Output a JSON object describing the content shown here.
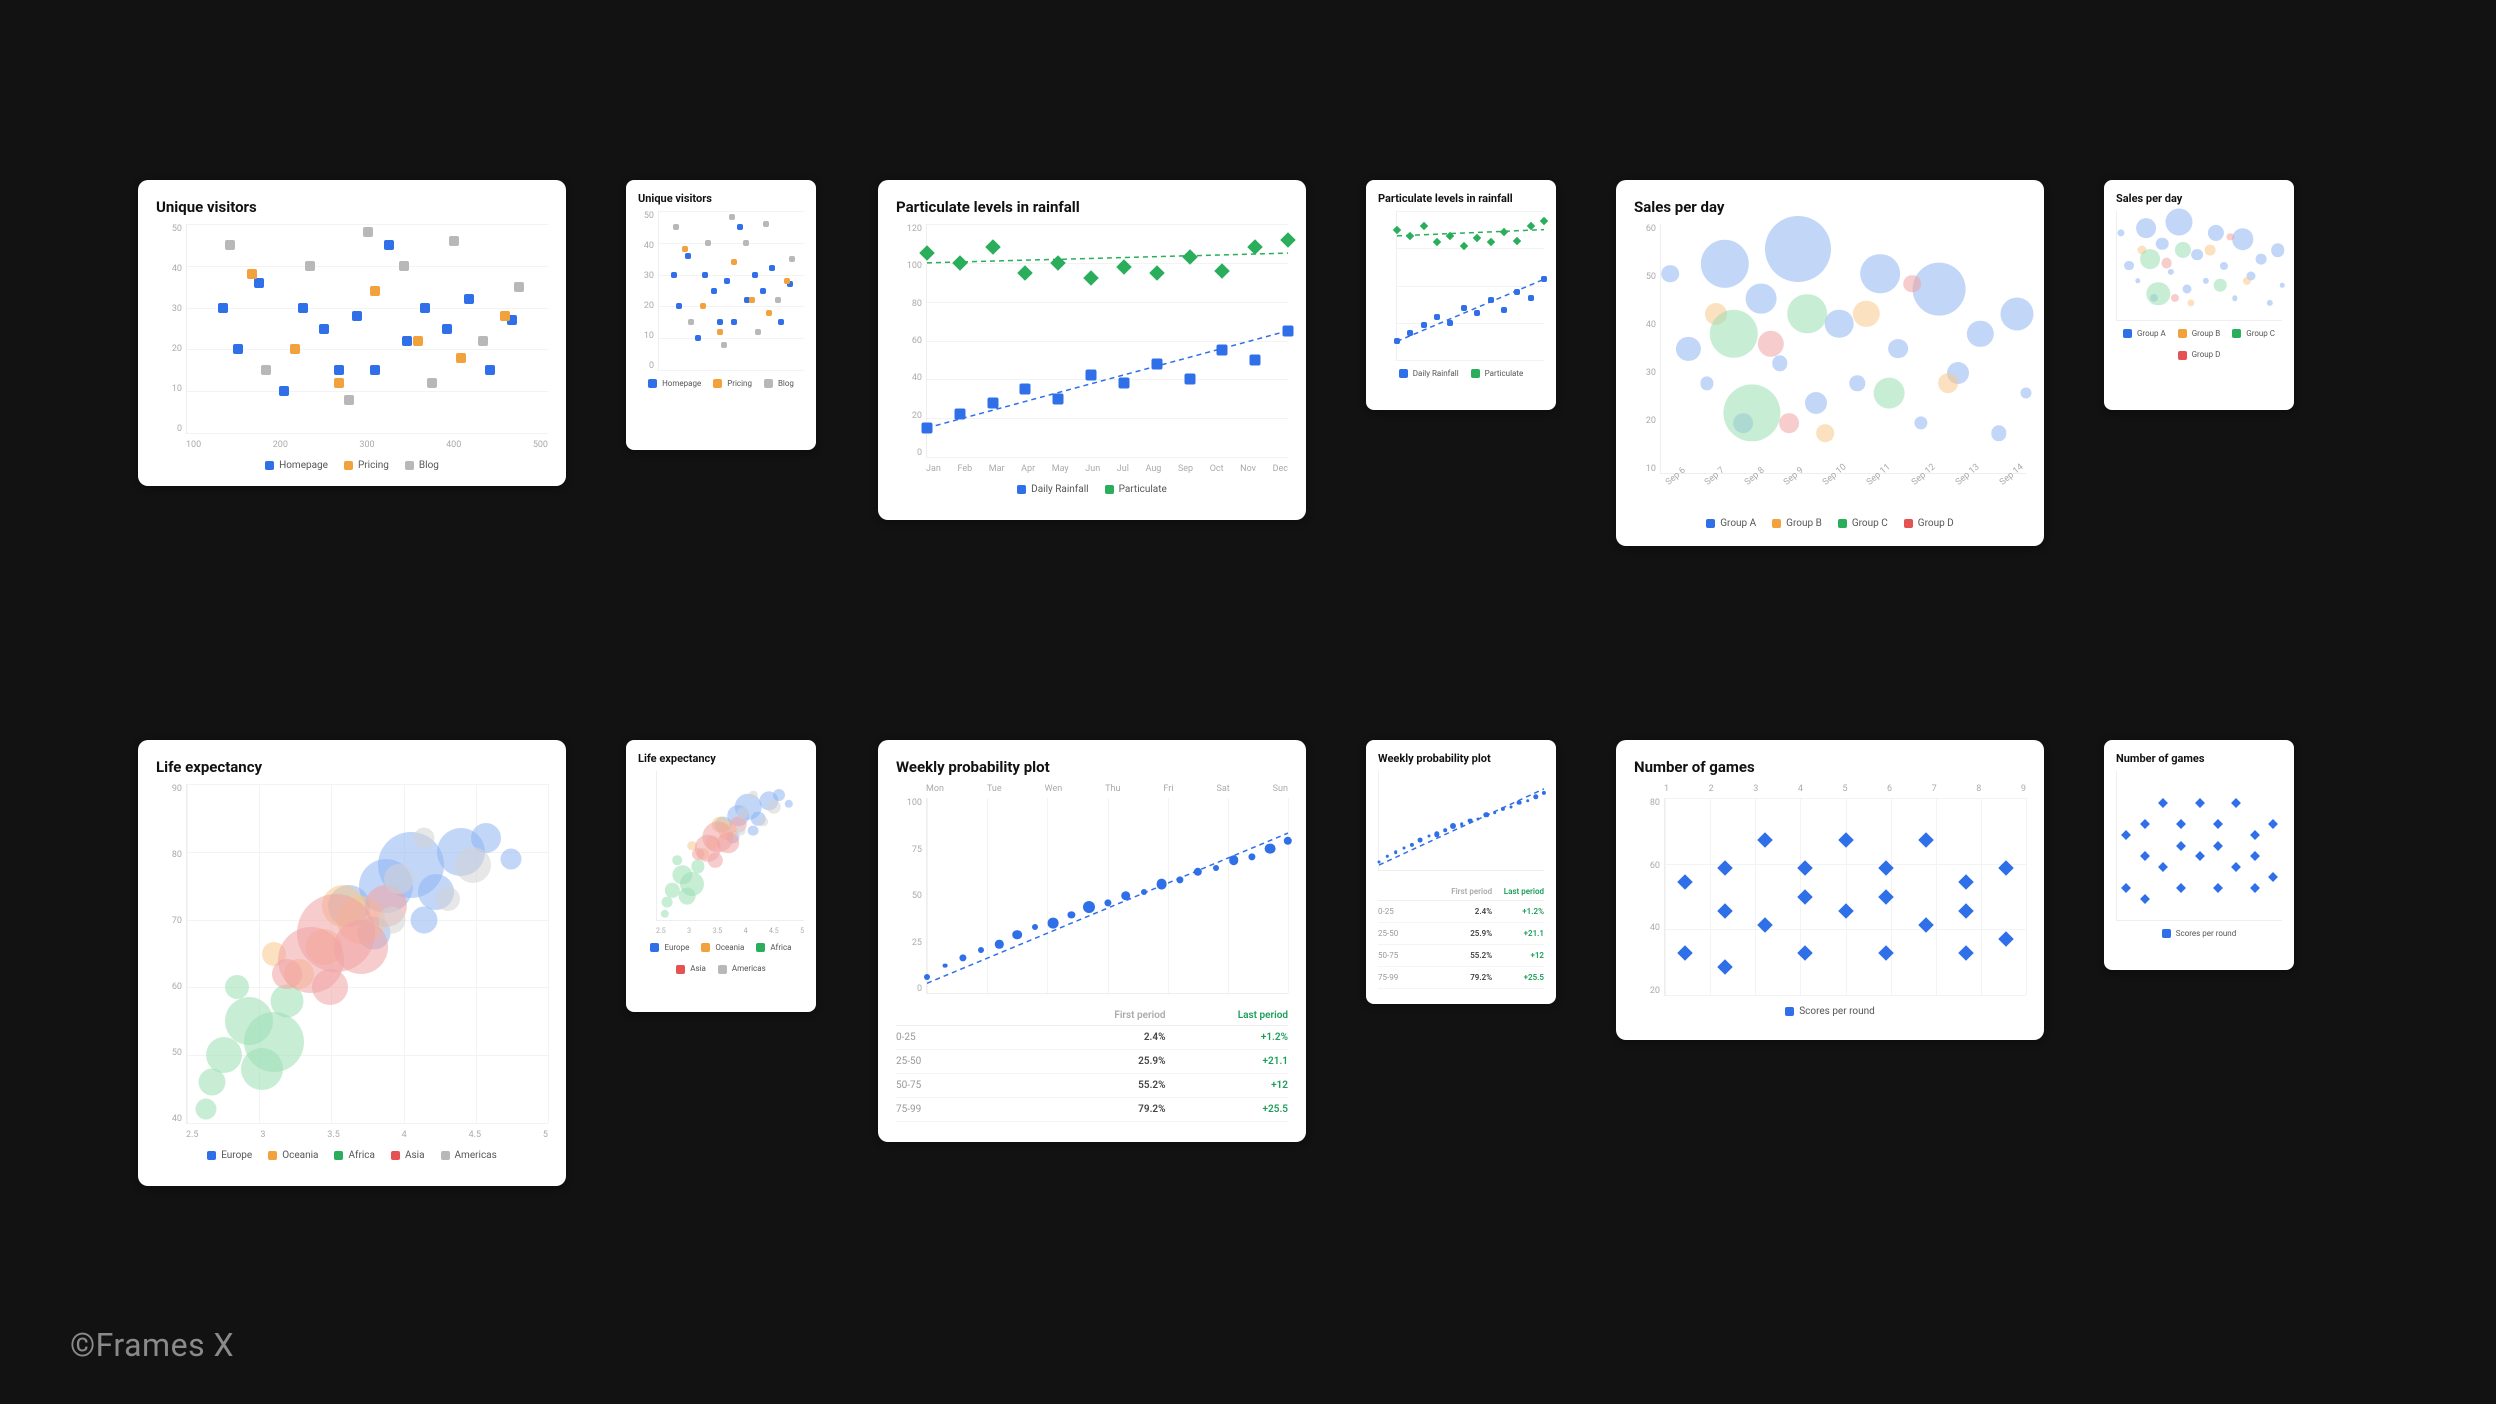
{
  "watermark": "©Frames X",
  "colors": {
    "blue": "#2f6fe8",
    "orange": "#f2a23c",
    "grey": "#b8b8b8",
    "green": "#2aae5b",
    "red": "#e45252",
    "blueFill": "#8fb4f2",
    "orangeFill": "#f7c98a",
    "greenFill": "#9bdeb2",
    "redFill": "#f1a3a3",
    "greyFill": "#d3d3d3"
  },
  "chart_data": [
    {
      "id": "unique_visitors",
      "title": "Unique visitors",
      "type": "scatter",
      "xlabel": "",
      "ylabel": "",
      "x_ticks": [
        100,
        200,
        300,
        400,
        500
      ],
      "y_ticks": [
        0,
        10,
        20,
        30,
        40,
        50
      ],
      "xlim": [
        50,
        550
      ],
      "ylim": [
        0,
        50
      ],
      "legend": [
        "Homepage",
        "Pricing",
        "Blog"
      ],
      "legend_colors": [
        "blue",
        "orange",
        "grey"
      ],
      "series": [
        {
          "name": "Homepage",
          "color": "blue",
          "shape": "square",
          "points": [
            [
              100,
              30
            ],
            [
              120,
              20
            ],
            [
              150,
              36
            ],
            [
              185,
              10
            ],
            [
              210,
              30
            ],
            [
              240,
              25
            ],
            [
              260,
              15
            ],
            [
              285,
              28
            ],
            [
              310,
              15
            ],
            [
              330,
              45
            ],
            [
              355,
              22
            ],
            [
              380,
              30
            ],
            [
              410,
              25
            ],
            [
              440,
              32
            ],
            [
              470,
              15
            ],
            [
              500,
              27
            ]
          ]
        },
        {
          "name": "Pricing",
          "color": "orange",
          "shape": "square",
          "points": [
            [
              140,
              38
            ],
            [
              200,
              20
            ],
            [
              260,
              12
            ],
            [
              310,
              34
            ],
            [
              370,
              22
            ],
            [
              430,
              18
            ],
            [
              490,
              28
            ]
          ]
        },
        {
          "name": "Blog",
          "color": "grey",
          "shape": "square",
          "points": [
            [
              110,
              45
            ],
            [
              160,
              15
            ],
            [
              220,
              40
            ],
            [
              275,
              8
            ],
            [
              300,
              48
            ],
            [
              350,
              40
            ],
            [
              390,
              12
            ],
            [
              420,
              46
            ],
            [
              460,
              22
            ],
            [
              510,
              35
            ]
          ]
        }
      ]
    },
    {
      "id": "particulate",
      "title": "Particulate levels in rainfall",
      "type": "scatter",
      "x_ticks": [
        "Jan",
        "Feb",
        "Mar",
        "Apr",
        "May",
        "Jun",
        "Jul",
        "Aug",
        "Sep",
        "Oct",
        "Nov",
        "Dec"
      ],
      "y_ticks": [
        0,
        20,
        40,
        60,
        80,
        100,
        120
      ],
      "xlim": [
        0,
        11
      ],
      "ylim": [
        0,
        120
      ],
      "legend": [
        "Daily Rainfall",
        "Particulate"
      ],
      "legend_colors": [
        "blue",
        "green"
      ],
      "trend_lines": true,
      "series": [
        {
          "name": "Daily Rainfall",
          "color": "blue",
          "shape": "square",
          "points": [
            [
              0,
              15
            ],
            [
              1,
              22
            ],
            [
              2,
              28
            ],
            [
              3,
              35
            ],
            [
              4,
              30
            ],
            [
              5,
              42
            ],
            [
              6,
              38
            ],
            [
              7,
              48
            ],
            [
              8,
              40
            ],
            [
              9,
              55
            ],
            [
              10,
              50
            ],
            [
              11,
              65
            ]
          ]
        },
        {
          "name": "Particulate",
          "color": "green",
          "shape": "diamond",
          "points": [
            [
              0,
              105
            ],
            [
              1,
              100
            ],
            [
              2,
              108
            ],
            [
              3,
              95
            ],
            [
              4,
              100
            ],
            [
              5,
              92
            ],
            [
              6,
              98
            ],
            [
              7,
              95
            ],
            [
              8,
              103
            ],
            [
              9,
              96
            ],
            [
              10,
              108
            ],
            [
              11,
              112
            ]
          ]
        }
      ]
    },
    {
      "id": "sales_per_day",
      "title": "Sales per day",
      "type": "bubble",
      "x_ticks": [
        "Sep 6",
        "Sep 7",
        "Sep 8",
        "Sep 9",
        "Sep 10",
        "Sep 11",
        "Sep 12",
        "Sep 13",
        "Sep 14"
      ],
      "y_ticks": [
        10,
        20,
        30,
        40,
        50,
        60
      ],
      "xlim": [
        0,
        8
      ],
      "ylim": [
        10,
        60
      ],
      "legend": [
        "Group A",
        "Group B",
        "Group C",
        "Group D"
      ],
      "legend_colors": [
        "blue",
        "orange",
        "green",
        "red"
      ],
      "series": [
        {
          "name": "Group A",
          "color": "blueFill",
          "points": [
            [
              0.2,
              50,
              8
            ],
            [
              0.6,
              35,
              11
            ],
            [
              1.0,
              28,
              6
            ],
            [
              1.4,
              52,
              22
            ],
            [
              1.8,
              20,
              9
            ],
            [
              2.2,
              45,
              14
            ],
            [
              2.6,
              32,
              7
            ],
            [
              3.0,
              55,
              30
            ],
            [
              3.4,
              24,
              10
            ],
            [
              3.9,
              40,
              13
            ],
            [
              4.3,
              28,
              7
            ],
            [
              4.8,
              50,
              18
            ],
            [
              5.2,
              35,
              9
            ],
            [
              5.7,
              20,
              6
            ],
            [
              6.1,
              47,
              24
            ],
            [
              6.5,
              30,
              10
            ],
            [
              7.0,
              38,
              12
            ],
            [
              7.4,
              18,
              7
            ],
            [
              7.8,
              42,
              15
            ],
            [
              8.0,
              26,
              5
            ]
          ]
        },
        {
          "name": "Group B",
          "color": "orangeFill",
          "points": [
            [
              1.2,
              42,
              10
            ],
            [
              3.6,
              18,
              8
            ],
            [
              4.5,
              42,
              12
            ],
            [
              6.3,
              28,
              9
            ]
          ]
        },
        {
          "name": "Group C",
          "color": "greenFill",
          "points": [
            [
              1.6,
              38,
              22
            ],
            [
              2.0,
              22,
              26
            ],
            [
              3.2,
              42,
              18
            ],
            [
              5.0,
              26,
              14
            ]
          ]
        },
        {
          "name": "Group D",
          "color": "redFill",
          "points": [
            [
              2.4,
              36,
              12
            ],
            [
              2.8,
              20,
              9
            ],
            [
              5.5,
              48,
              8
            ]
          ]
        }
      ]
    },
    {
      "id": "life_expectancy",
      "title": "Life expectancy",
      "type": "bubble",
      "x_ticks": [
        2.5,
        3,
        3.5,
        4,
        4.5,
        5
      ],
      "y_ticks": [
        40,
        50,
        60,
        70,
        80,
        90
      ],
      "xlim": [
        2.3,
        5.2
      ],
      "ylim": [
        40,
        90
      ],
      "legend": [
        "Europe",
        "Oceania",
        "Africa",
        "Asia",
        "Americas"
      ],
      "legend_colors": [
        "blue",
        "orange",
        "green",
        "red",
        "grey"
      ],
      "series": [
        {
          "name": "Europe",
          "color": "blueFill",
          "points": [
            [
              3.6,
              72,
              14
            ],
            [
              3.9,
              75,
              18
            ],
            [
              4.1,
              78,
              22
            ],
            [
              4.3,
              74,
              12
            ],
            [
              4.5,
              80,
              16
            ],
            [
              4.7,
              82,
              10
            ],
            [
              4.2,
              70,
              9
            ],
            [
              3.8,
              68,
              11
            ],
            [
              4.9,
              79,
              7
            ]
          ]
        },
        {
          "name": "Oceania",
          "color": "orangeFill",
          "points": [
            [
              3.4,
              66,
              12
            ],
            [
              3.7,
              70,
              16
            ],
            [
              3.2,
              62,
              10
            ],
            [
              3.55,
              72,
              14
            ],
            [
              3.0,
              65,
              8
            ]
          ]
        },
        {
          "name": "Africa",
          "color": "greenFill",
          "points": [
            [
              2.6,
              50,
              12
            ],
            [
              2.8,
              55,
              16
            ],
            [
              3.0,
              52,
              20
            ],
            [
              2.5,
              46,
              9
            ],
            [
              3.1,
              58,
              11
            ],
            [
              2.7,
              60,
              8
            ],
            [
              2.9,
              48,
              14
            ],
            [
              2.45,
              42,
              7
            ]
          ]
        },
        {
          "name": "Asia",
          "color": "redFill",
          "points": [
            [
              3.3,
              64,
              22
            ],
            [
              3.5,
              68,
              26
            ],
            [
              3.7,
              66,
              18
            ],
            [
              3.9,
              72,
              14
            ],
            [
              3.45,
              60,
              12
            ],
            [
              3.1,
              62,
              10
            ]
          ]
        },
        {
          "name": "Americas",
          "color": "greyFill",
          "points": [
            [
              4.0,
              76,
              10
            ],
            [
              4.4,
              73,
              8
            ],
            [
              4.6,
              78,
              12
            ],
            [
              3.95,
              70,
              9
            ],
            [
              4.2,
              82,
              7
            ]
          ]
        }
      ]
    },
    {
      "id": "weekly_probability",
      "title": "Weekly probability plot",
      "type": "scatter",
      "x_ticks": [
        "Mon",
        "Tue",
        "Wen",
        "Thu",
        "Fri",
        "Sat",
        "Sun"
      ],
      "y_ticks": [
        0,
        25,
        50,
        75,
        100
      ],
      "xlim": [
        0,
        6
      ],
      "ylim": [
        0,
        100
      ],
      "legend": [],
      "trend_lines": true,
      "series": [
        {
          "name": "prob",
          "color": "blue",
          "shape": "dot",
          "points": [
            [
              0.0,
              8,
              5
            ],
            [
              0.3,
              14,
              4
            ],
            [
              0.6,
              18,
              6
            ],
            [
              0.9,
              22,
              5
            ],
            [
              1.2,
              25,
              7
            ],
            [
              1.5,
              30,
              8
            ],
            [
              1.8,
              34,
              5
            ],
            [
              2.1,
              36,
              9
            ],
            [
              2.4,
              40,
              6
            ],
            [
              2.7,
              44,
              10
            ],
            [
              3.0,
              46,
              6
            ],
            [
              3.3,
              50,
              8
            ],
            [
              3.6,
              52,
              5
            ],
            [
              3.9,
              56,
              9
            ],
            [
              4.2,
              58,
              6
            ],
            [
              4.5,
              62,
              7
            ],
            [
              4.8,
              64,
              5
            ],
            [
              5.1,
              68,
              8
            ],
            [
              5.4,
              70,
              6
            ],
            [
              5.7,
              74,
              9
            ],
            [
              6.0,
              78,
              7
            ]
          ]
        }
      ],
      "table": {
        "headers": [
          "",
          "First period",
          "Last period"
        ],
        "rows": [
          [
            "0-25",
            "2.4%",
            "+1.2%"
          ],
          [
            "25-50",
            "25.9%",
            "+21.1"
          ],
          [
            "50-75",
            "55.2%",
            "+12"
          ],
          [
            "75-99",
            "79.2%",
            "+25.5"
          ]
        ]
      }
    },
    {
      "id": "number_of_games",
      "title": "Number of games",
      "type": "scatter",
      "x_ticks": [
        1,
        2,
        3,
        4,
        5,
        6,
        7,
        8,
        9
      ],
      "y_ticks": [
        20,
        40,
        60,
        80
      ],
      "xlim": [
        0.5,
        9.5
      ],
      "ylim": [
        15,
        85
      ],
      "legend": [
        "Scores per round"
      ],
      "legend_colors": [
        "blue"
      ],
      "series": [
        {
          "name": "Scores per round",
          "color": "blue",
          "shape": "diamond",
          "points": [
            [
              1,
              30
            ],
            [
              1,
              55
            ],
            [
              2,
              25
            ],
            [
              2,
              60
            ],
            [
              3,
              40
            ],
            [
              3,
              70
            ],
            [
              4,
              30
            ],
            [
              4,
              60
            ],
            [
              5,
              45
            ],
            [
              5,
              70
            ],
            [
              6,
              30
            ],
            [
              6,
              60
            ],
            [
              7,
              40
            ],
            [
              7,
              70
            ],
            [
              8,
              30
            ],
            [
              8,
              55
            ],
            [
              9,
              35
            ],
            [
              9,
              60
            ],
            [
              2,
              45
            ],
            [
              4,
              50
            ],
            [
              6,
              50
            ],
            [
              8,
              45
            ]
          ]
        }
      ]
    }
  ]
}
